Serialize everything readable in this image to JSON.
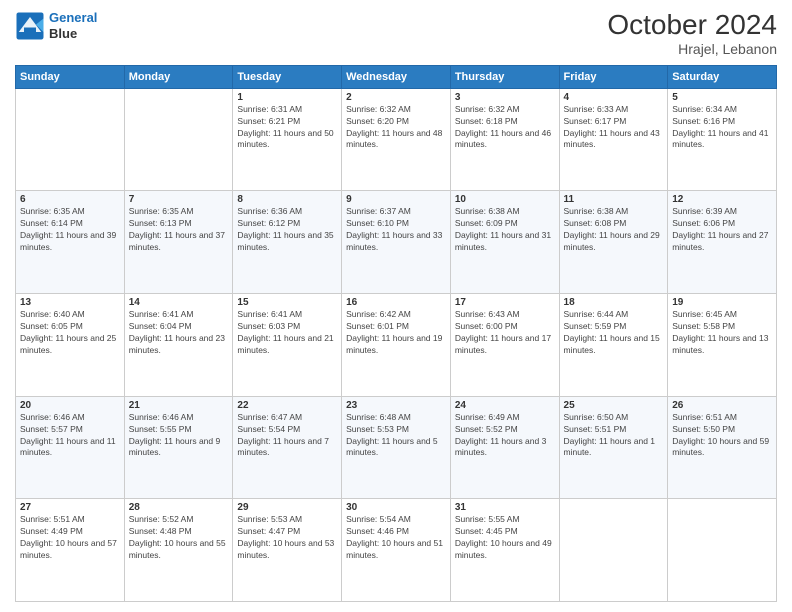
{
  "header": {
    "logo_line1": "General",
    "logo_line2": "Blue",
    "title": "October 2024",
    "subtitle": "Hrajel, Lebanon"
  },
  "days_of_week": [
    "Sunday",
    "Monday",
    "Tuesday",
    "Wednesday",
    "Thursday",
    "Friday",
    "Saturday"
  ],
  "weeks": [
    [
      {
        "num": "",
        "sunrise": "",
        "sunset": "",
        "daylight": ""
      },
      {
        "num": "",
        "sunrise": "",
        "sunset": "",
        "daylight": ""
      },
      {
        "num": "1",
        "sunrise": "Sunrise: 6:31 AM",
        "sunset": "Sunset: 6:21 PM",
        "daylight": "Daylight: 11 hours and 50 minutes."
      },
      {
        "num": "2",
        "sunrise": "Sunrise: 6:32 AM",
        "sunset": "Sunset: 6:20 PM",
        "daylight": "Daylight: 11 hours and 48 minutes."
      },
      {
        "num": "3",
        "sunrise": "Sunrise: 6:32 AM",
        "sunset": "Sunset: 6:18 PM",
        "daylight": "Daylight: 11 hours and 46 minutes."
      },
      {
        "num": "4",
        "sunrise": "Sunrise: 6:33 AM",
        "sunset": "Sunset: 6:17 PM",
        "daylight": "Daylight: 11 hours and 43 minutes."
      },
      {
        "num": "5",
        "sunrise": "Sunrise: 6:34 AM",
        "sunset": "Sunset: 6:16 PM",
        "daylight": "Daylight: 11 hours and 41 minutes."
      }
    ],
    [
      {
        "num": "6",
        "sunrise": "Sunrise: 6:35 AM",
        "sunset": "Sunset: 6:14 PM",
        "daylight": "Daylight: 11 hours and 39 minutes."
      },
      {
        "num": "7",
        "sunrise": "Sunrise: 6:35 AM",
        "sunset": "Sunset: 6:13 PM",
        "daylight": "Daylight: 11 hours and 37 minutes."
      },
      {
        "num": "8",
        "sunrise": "Sunrise: 6:36 AM",
        "sunset": "Sunset: 6:12 PM",
        "daylight": "Daylight: 11 hours and 35 minutes."
      },
      {
        "num": "9",
        "sunrise": "Sunrise: 6:37 AM",
        "sunset": "Sunset: 6:10 PM",
        "daylight": "Daylight: 11 hours and 33 minutes."
      },
      {
        "num": "10",
        "sunrise": "Sunrise: 6:38 AM",
        "sunset": "Sunset: 6:09 PM",
        "daylight": "Daylight: 11 hours and 31 minutes."
      },
      {
        "num": "11",
        "sunrise": "Sunrise: 6:38 AM",
        "sunset": "Sunset: 6:08 PM",
        "daylight": "Daylight: 11 hours and 29 minutes."
      },
      {
        "num": "12",
        "sunrise": "Sunrise: 6:39 AM",
        "sunset": "Sunset: 6:06 PM",
        "daylight": "Daylight: 11 hours and 27 minutes."
      }
    ],
    [
      {
        "num": "13",
        "sunrise": "Sunrise: 6:40 AM",
        "sunset": "Sunset: 6:05 PM",
        "daylight": "Daylight: 11 hours and 25 minutes."
      },
      {
        "num": "14",
        "sunrise": "Sunrise: 6:41 AM",
        "sunset": "Sunset: 6:04 PM",
        "daylight": "Daylight: 11 hours and 23 minutes."
      },
      {
        "num": "15",
        "sunrise": "Sunrise: 6:41 AM",
        "sunset": "Sunset: 6:03 PM",
        "daylight": "Daylight: 11 hours and 21 minutes."
      },
      {
        "num": "16",
        "sunrise": "Sunrise: 6:42 AM",
        "sunset": "Sunset: 6:01 PM",
        "daylight": "Daylight: 11 hours and 19 minutes."
      },
      {
        "num": "17",
        "sunrise": "Sunrise: 6:43 AM",
        "sunset": "Sunset: 6:00 PM",
        "daylight": "Daylight: 11 hours and 17 minutes."
      },
      {
        "num": "18",
        "sunrise": "Sunrise: 6:44 AM",
        "sunset": "Sunset: 5:59 PM",
        "daylight": "Daylight: 11 hours and 15 minutes."
      },
      {
        "num": "19",
        "sunrise": "Sunrise: 6:45 AM",
        "sunset": "Sunset: 5:58 PM",
        "daylight": "Daylight: 11 hours and 13 minutes."
      }
    ],
    [
      {
        "num": "20",
        "sunrise": "Sunrise: 6:46 AM",
        "sunset": "Sunset: 5:57 PM",
        "daylight": "Daylight: 11 hours and 11 minutes."
      },
      {
        "num": "21",
        "sunrise": "Sunrise: 6:46 AM",
        "sunset": "Sunset: 5:55 PM",
        "daylight": "Daylight: 11 hours and 9 minutes."
      },
      {
        "num": "22",
        "sunrise": "Sunrise: 6:47 AM",
        "sunset": "Sunset: 5:54 PM",
        "daylight": "Daylight: 11 hours and 7 minutes."
      },
      {
        "num": "23",
        "sunrise": "Sunrise: 6:48 AM",
        "sunset": "Sunset: 5:53 PM",
        "daylight": "Daylight: 11 hours and 5 minutes."
      },
      {
        "num": "24",
        "sunrise": "Sunrise: 6:49 AM",
        "sunset": "Sunset: 5:52 PM",
        "daylight": "Daylight: 11 hours and 3 minutes."
      },
      {
        "num": "25",
        "sunrise": "Sunrise: 6:50 AM",
        "sunset": "Sunset: 5:51 PM",
        "daylight": "Daylight: 11 hours and 1 minute."
      },
      {
        "num": "26",
        "sunrise": "Sunrise: 6:51 AM",
        "sunset": "Sunset: 5:50 PM",
        "daylight": "Daylight: 10 hours and 59 minutes."
      }
    ],
    [
      {
        "num": "27",
        "sunrise": "Sunrise: 5:51 AM",
        "sunset": "Sunset: 4:49 PM",
        "daylight": "Daylight: 10 hours and 57 minutes."
      },
      {
        "num": "28",
        "sunrise": "Sunrise: 5:52 AM",
        "sunset": "Sunset: 4:48 PM",
        "daylight": "Daylight: 10 hours and 55 minutes."
      },
      {
        "num": "29",
        "sunrise": "Sunrise: 5:53 AM",
        "sunset": "Sunset: 4:47 PM",
        "daylight": "Daylight: 10 hours and 53 minutes."
      },
      {
        "num": "30",
        "sunrise": "Sunrise: 5:54 AM",
        "sunset": "Sunset: 4:46 PM",
        "daylight": "Daylight: 10 hours and 51 minutes."
      },
      {
        "num": "31",
        "sunrise": "Sunrise: 5:55 AM",
        "sunset": "Sunset: 4:45 PM",
        "daylight": "Daylight: 10 hours and 49 minutes."
      },
      {
        "num": "",
        "sunrise": "",
        "sunset": "",
        "daylight": ""
      },
      {
        "num": "",
        "sunrise": "",
        "sunset": "",
        "daylight": ""
      }
    ]
  ]
}
